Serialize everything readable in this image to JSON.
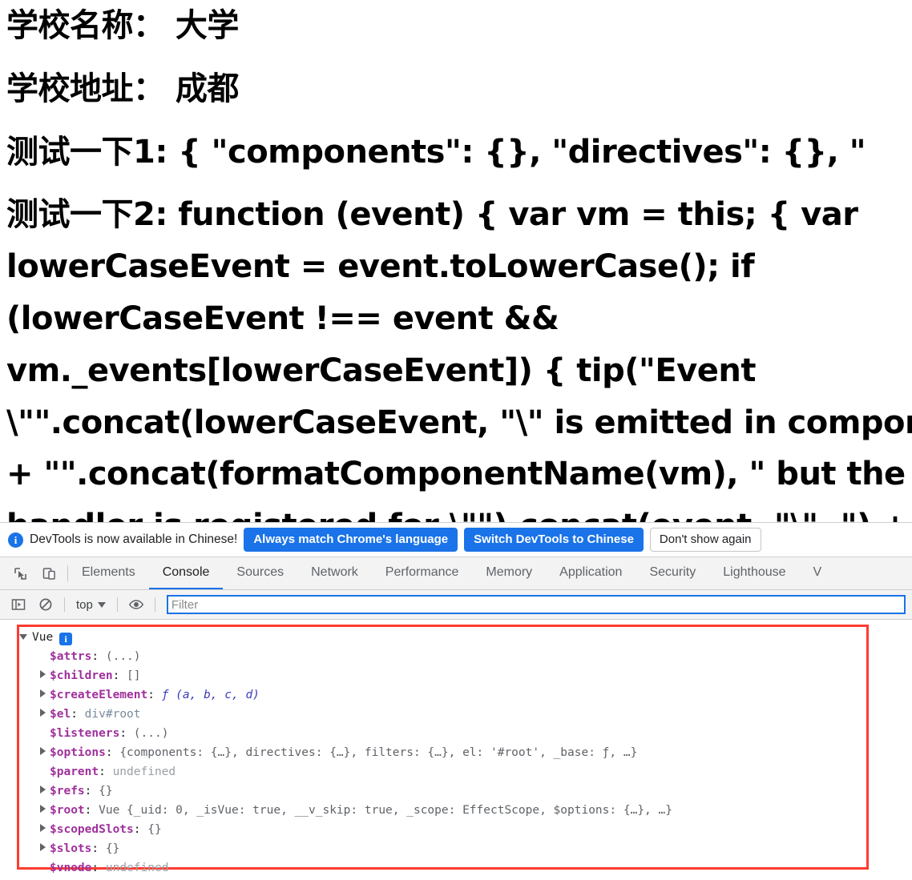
{
  "page": {
    "lines": [
      {
        "text": "学校名称： 大学",
        "wrap": false
      },
      {
        "text": "学校地址： 成都",
        "wrap": false
      },
      {
        "text": "测试一下1: { \"components\": {}, \"directives\": {}, \"",
        "wrap": false
      },
      {
        "text": "测试一下2: function (event) { var vm = this; { var lowerCaseEvent = event.toLowerCase(); if (lowerCaseEvent !== event && vm._events[lowerCaseEvent]) { tip(\"Event \\\"\".concat(lowerCaseEvent, \"\\\" is emitted in component \") + \"\".concat(formatComponentName(vm), \" but the handler is registered for \\\"\").concat(event, \"\\\". \") + \"Note that HTML attributes are case-insensitive and you cannot use \" + \"v-on to listen to camelCase events when using in-DOM templates. \"",
        "wrap": true
      }
    ]
  },
  "infobar": {
    "icon": "info-icon",
    "message": "DevTools is now available in Chinese!",
    "buttons": [
      {
        "label": "Always match Chrome's language",
        "style": "primary"
      },
      {
        "label": "Switch DevTools to Chinese",
        "style": "primary"
      },
      {
        "label": "Don't show again",
        "style": "secondary"
      }
    ]
  },
  "tabstrip": {
    "icons": [
      {
        "name": "inspect-element-icon"
      },
      {
        "name": "device-toolbar-icon"
      }
    ],
    "tabs": [
      {
        "label": "Elements",
        "active": false
      },
      {
        "label": "Console",
        "active": true
      },
      {
        "label": "Sources",
        "active": false
      },
      {
        "label": "Network",
        "active": false
      },
      {
        "label": "Performance",
        "active": false
      },
      {
        "label": "Memory",
        "active": false
      },
      {
        "label": "Application",
        "active": false
      },
      {
        "label": "Security",
        "active": false
      },
      {
        "label": "Lighthouse",
        "active": false
      },
      {
        "label": "V",
        "active": false
      }
    ]
  },
  "console_toolbar": {
    "execute_icon": "console-sidebar-icon",
    "clear_icon": "clear-console-icon",
    "context": "top",
    "eye_icon": "live-expression-icon",
    "filter_value": "",
    "filter_placeholder": "Filter"
  },
  "console_log": {
    "title": "Vue",
    "badge": "i",
    "expanded": true,
    "properties": [
      {
        "expandable": false,
        "name": "$attrs",
        "value": "(...)",
        "value_class": "val-ellipsis"
      },
      {
        "expandable": true,
        "name": "$children",
        "value": "[]",
        "value_class": "val-generic"
      },
      {
        "expandable": true,
        "name": "$createElement",
        "value": "ƒ (a, b, c, d)",
        "value_class": "val-fn"
      },
      {
        "expandable": true,
        "name": "$el",
        "value": "div#root",
        "value_class": "val-node"
      },
      {
        "expandable": false,
        "name": "$listeners",
        "value": "(...)",
        "value_class": "val-ellipsis"
      },
      {
        "expandable": true,
        "name": "$options",
        "value": "{components: {…}, directives: {…}, filters: {…}, el: '#root', _base: ƒ, …}",
        "value_class": "val-generic"
      },
      {
        "expandable": false,
        "name": "$parent",
        "value": "undefined",
        "value_class": "val-undefined"
      },
      {
        "expandable": true,
        "name": "$refs",
        "value": "{}",
        "value_class": "val-generic"
      },
      {
        "expandable": true,
        "name": "$root",
        "value": "Vue {_uid: 0, _isVue: true, __v_skip: true, _scope: EffectScope, $options: {…}, …}",
        "value_class": "val-generic"
      },
      {
        "expandable": true,
        "name": "$scopedSlots",
        "value": "{}",
        "value_class": "val-generic"
      },
      {
        "expandable": true,
        "name": "$slots",
        "value": "{}",
        "value_class": "val-generic"
      },
      {
        "expandable": false,
        "name": "$vnode",
        "value": "undefined",
        "value_class": "val-undefined"
      }
    ]
  },
  "colors": {
    "accent_blue": "#1a73e8",
    "highlight_red": "#ff3b30",
    "property_magenta": "#a0309c",
    "string_red": "#c41a16",
    "number_blue": "#1a1aa6"
  }
}
